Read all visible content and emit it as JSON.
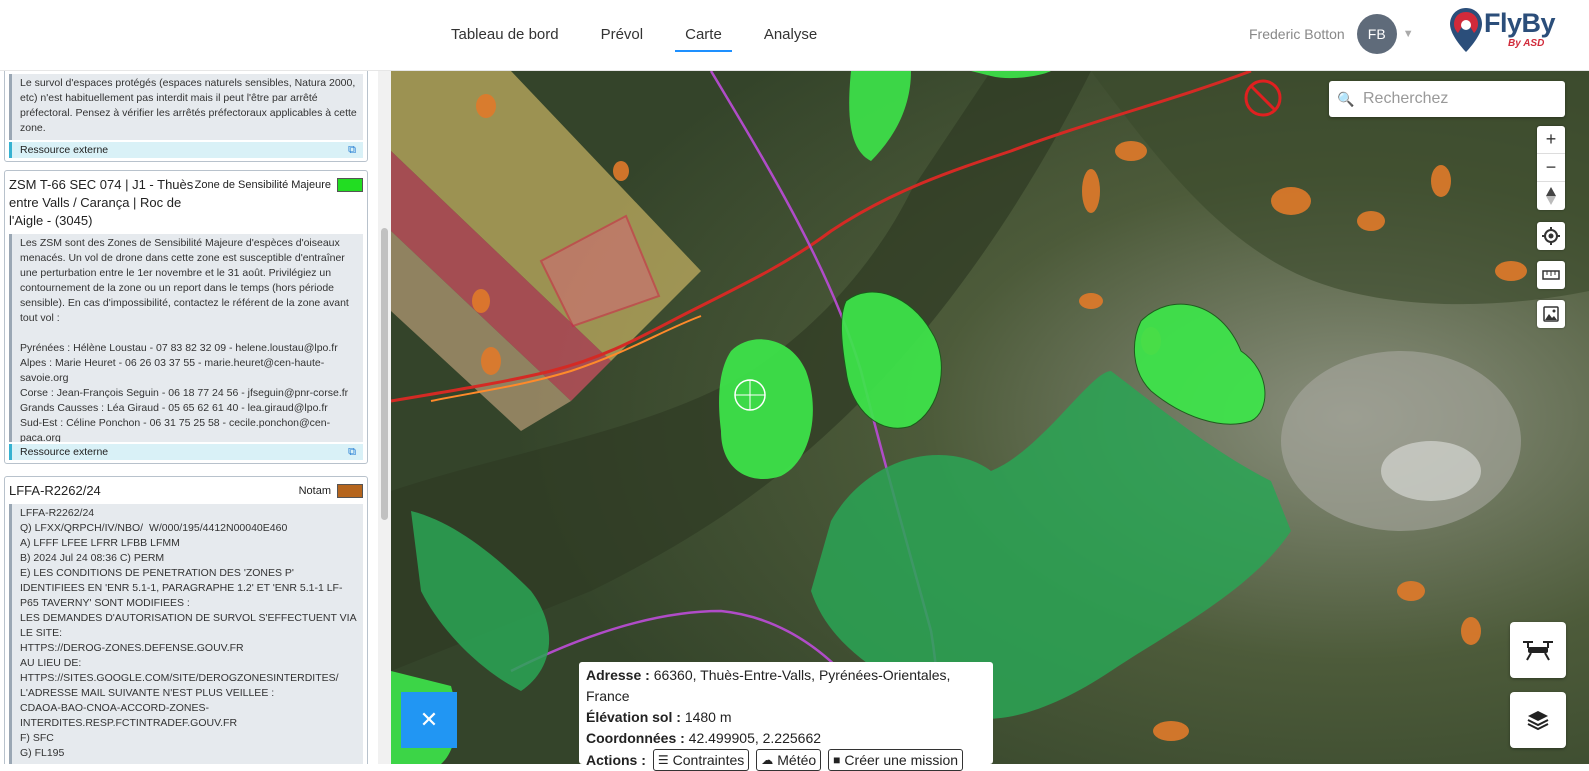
{
  "nav": {
    "items": [
      "Tableau de bord",
      "Prévol",
      "Carte",
      "Analyse"
    ],
    "active": "Carte"
  },
  "user": {
    "name": "Frederic Botton",
    "initials": "FB"
  },
  "logo": {
    "name": "FlyBy",
    "sub": "By ASD"
  },
  "panel": {
    "card0": {
      "body": "Le survol d'espaces protégés (espaces naturels sensibles, Natura 2000, etc) n'est habituellement pas interdit mais il peut l'être par arrêté préfectoral. Pensez à vérifier les arrêtés préfectoraux applicables à cette zone.",
      "link": "Ressource externe"
    },
    "card1": {
      "title": "ZSM T-66 SEC 074 | J1 - Thuès entre Valls / Carança | Roc de l'Aigle - (3045)",
      "type": "Zone de Sensibilité Majeure",
      "color": "#22dd22",
      "body": "Les ZSM sont des Zones de Sensibilité Majeure d'espèces d'oiseaux menacés. Un vol de drone dans cette zone est susceptible d'entraîner une perturbation entre le 1er novembre et le 31 août. Privilégiez un contournement de la zone ou un report dans le temps (hors période sensible). En cas d'impossibilité, contactez le référent de la zone avant tout vol :\n\nPyrénées : Hélène Loustau - 07 83 82 32 09 - helene.loustau@lpo.fr\nAlpes : Marie Heuret - 06 26 03 37 55 - marie.heuret@cen-haute-savoie.org\nCorse : Jean-François Seguin - 06 18 77 24 56 - jfseguin@pnr-corse.fr\nGrands Causses : Léa Giraud - 05 65 62 61 40 - lea.giraud@lpo.fr\nSud-Est : Céline Ponchon - 06 31 75 25 58 - cecile.ponchon@cen-paca.org",
      "link": "Ressource externe"
    },
    "card2": {
      "title": "LFFA-R2262/24",
      "type": "Notam",
      "color": "#b5651d",
      "body": "LFFA-R2262/24\nQ) LFXX/QRPCH/IV/NBO/  W/000/195/4412N00040E460\nA) LFFF LFEE LFRR LFBB LFMM\nB) 2024 Jul 24 08:36 C) PERM\nE) LES CONDITIONS DE PENETRATION DES 'ZONES P' IDENTIFIEES EN 'ENR 5.1-1, PARAGRAPHE 1.2' ET 'ENR 5.1-1 LF-P65 TAVERNY' SONT MODIFIEES :\nLES DEMANDES D'AUTORISATION DE SURVOL S'EFFECTUENT VIA LE SITE:\nHTTPS://DEROG-ZONES.DEFENSE.GOUV.FR\nAU LIEU DE:\nHTTPS://SITES.GOOGLE.COM/SITE/DEROGZONESINTERDITES/\nL'ADRESSE MAIL SUIVANTE N'EST PLUS VEILLEE :\nCDAOA-BAO-CNOA-ACCORD-ZONES-INTERDITES.RESP.FCTINTRADEF.GOUV.FR\nF) SFC\nG) FL195"
    }
  },
  "search": {
    "placeholder": "Recherchez"
  },
  "popup": {
    "address_label": "Adresse :",
    "address": "66360, Thuès-Entre-Valls, Pyrénées-Orientales, France",
    "elevation_label": "Élévation sol :",
    "elevation": "1480 m",
    "coords_label": "Coordonnées :",
    "coords": "42.499905, 2.225662",
    "actions_label": "Actions :",
    "btn_constraints": "Contraintes",
    "btn_weather": "Météo",
    "btn_mission": "Créer une mission"
  },
  "colors": {
    "accent": "#1e90ff",
    "zsm": "#22dd22",
    "notam": "#b5651d",
    "close_button": "#2196f3"
  },
  "icons": [
    "search-icon",
    "zoom-in-icon",
    "zoom-out-icon",
    "compass-icon",
    "locate-icon",
    "ruler-icon",
    "map-image-icon",
    "drone-icon",
    "layers-icon",
    "close-icon",
    "external-link-icon"
  ]
}
